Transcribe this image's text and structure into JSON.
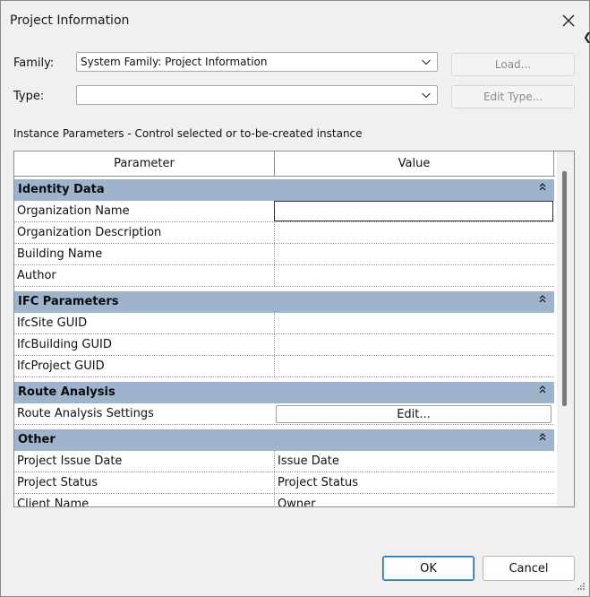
{
  "window": {
    "title": "Project Information",
    "peek_glyph": "❮"
  },
  "family": {
    "label": "Family:",
    "value": "System Family: Project Information",
    "load_label": "Load..."
  },
  "type": {
    "label": "Type:",
    "value": "",
    "edit_type_label": "Edit Type..."
  },
  "instance_parameters_label": "Instance Parameters - Control selected or to-be-created instance",
  "grid": {
    "col_parameter": "Parameter",
    "col_value": "Value",
    "groups": [
      {
        "name": "Identity Data",
        "rows": [
          {
            "param": "Organization Name",
            "value": ""
          },
          {
            "param": "Organization Description",
            "value": ""
          },
          {
            "param": "Building Name",
            "value": ""
          },
          {
            "param": "Author",
            "value": ""
          }
        ]
      },
      {
        "name": "IFC Parameters",
        "rows": [
          {
            "param": "IfcSite GUID",
            "value": ""
          },
          {
            "param": "IfcBuilding GUID",
            "value": ""
          },
          {
            "param": "IfcProject GUID",
            "value": ""
          }
        ]
      },
      {
        "name": "Route Analysis",
        "rows": [
          {
            "param": "Route Analysis Settings",
            "value": "Edit..."
          }
        ]
      },
      {
        "name": "Other",
        "rows": [
          {
            "param": "Project Issue Date",
            "value": "Issue Date"
          },
          {
            "param": "Project Status",
            "value": "Project Status"
          },
          {
            "param": "Client Name",
            "value": "Owner"
          }
        ]
      }
    ]
  },
  "buttons": {
    "ok": "OK",
    "cancel": "Cancel"
  },
  "icons": {
    "close": "close-icon",
    "chevron": "chevron-down-icon",
    "collapse": "double-chevron-up-icon",
    "resize": "resize-grip-icon"
  },
  "colors": {
    "group_header": "#9db4cc",
    "dialog_bg": "#f0f0f0",
    "ok_border": "#1e6fbf"
  }
}
